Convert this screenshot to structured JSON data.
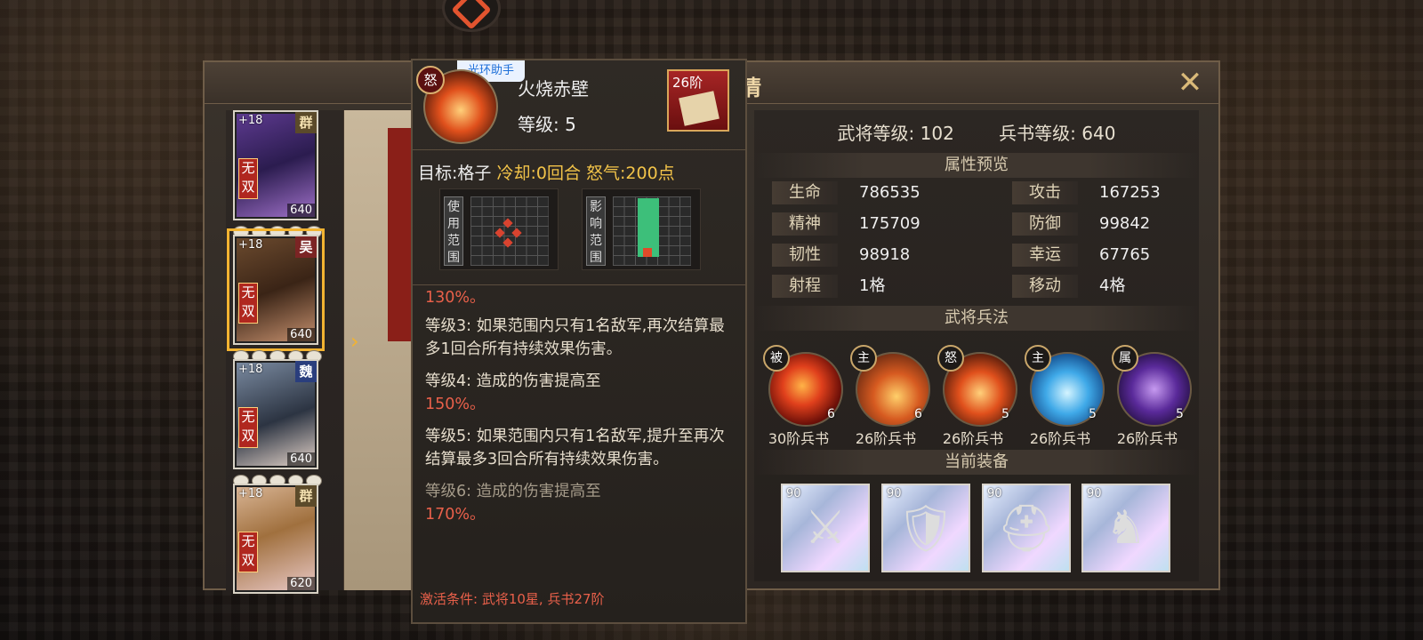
{
  "header": {
    "title_partial": "情",
    "close_icon": "close-icon"
  },
  "heroes": [
    {
      "plus": "+18",
      "faction": "群",
      "tag": "无双",
      "power": "640"
    },
    {
      "plus": "+18",
      "faction": "吴",
      "tag": "无双",
      "power": "640"
    },
    {
      "plus": "+18",
      "faction": "魏",
      "tag": "无双",
      "power": "640"
    },
    {
      "plus": "+18",
      "faction": "群",
      "tag": "无双",
      "power": "620"
    }
  ],
  "stats_panel": {
    "general_level_label": "武将等级:",
    "general_level": "102",
    "book_level_label": "兵书等级:",
    "book_level": "640",
    "attr_section": "属性预览",
    "attrs": [
      {
        "label": "生命",
        "value": "786535"
      },
      {
        "label": "攻击",
        "value": "167253"
      },
      {
        "label": "精神",
        "value": "175709"
      },
      {
        "label": "防御",
        "value": "99842"
      },
      {
        "label": "韧性",
        "value": "98918"
      },
      {
        "label": "幸运",
        "value": "67765"
      },
      {
        "label": "射程",
        "value": "1格"
      },
      {
        "label": "移动",
        "value": "4格"
      }
    ],
    "skills_section": "武将兵法",
    "skills": [
      {
        "type": "被",
        "level": "6",
        "name": "30阶兵书"
      },
      {
        "type": "主",
        "level": "6",
        "name": "26阶兵书"
      },
      {
        "type": "怒",
        "level": "5",
        "name": "26阶兵书"
      },
      {
        "type": "主",
        "level": "5",
        "name": "26阶兵书"
      },
      {
        "type": "属",
        "level": "5",
        "name": "26阶兵书"
      }
    ],
    "equip_section": "当前装备",
    "equipment": [
      {
        "level": "90",
        "icon": "sword-icon"
      },
      {
        "level": "90",
        "icon": "armor-icon"
      },
      {
        "level": "90",
        "icon": "helmet-icon"
      },
      {
        "level": "90",
        "icon": "horse-icon"
      }
    ]
  },
  "tooltip": {
    "helper_badge": "光环助手",
    "skill_type": "怒",
    "skill_name": "火烧赤壁",
    "level": "等级: 5",
    "book_tier": "26阶",
    "target": "目标:格子",
    "cooldown": "冷却:0回合",
    "rage": "怒气:200点",
    "use_range": "使用范围",
    "effect_range": "影响范围",
    "cut_line": "130%。",
    "lines": [
      "等级3: 如果范围内只有1名敌军,再次结算最多1回合所有持续效果伤害。",
      "等级4: 造成的伤害提高至",
      "150%。",
      "等级5: 如果范围内只有1名敌军,提升至再次结算最多3回合所有持续效果伤害。",
      "等级6: 造成的伤害提高至",
      "170%。"
    ],
    "activate": "激活条件: 武将10星, 兵书27阶"
  }
}
